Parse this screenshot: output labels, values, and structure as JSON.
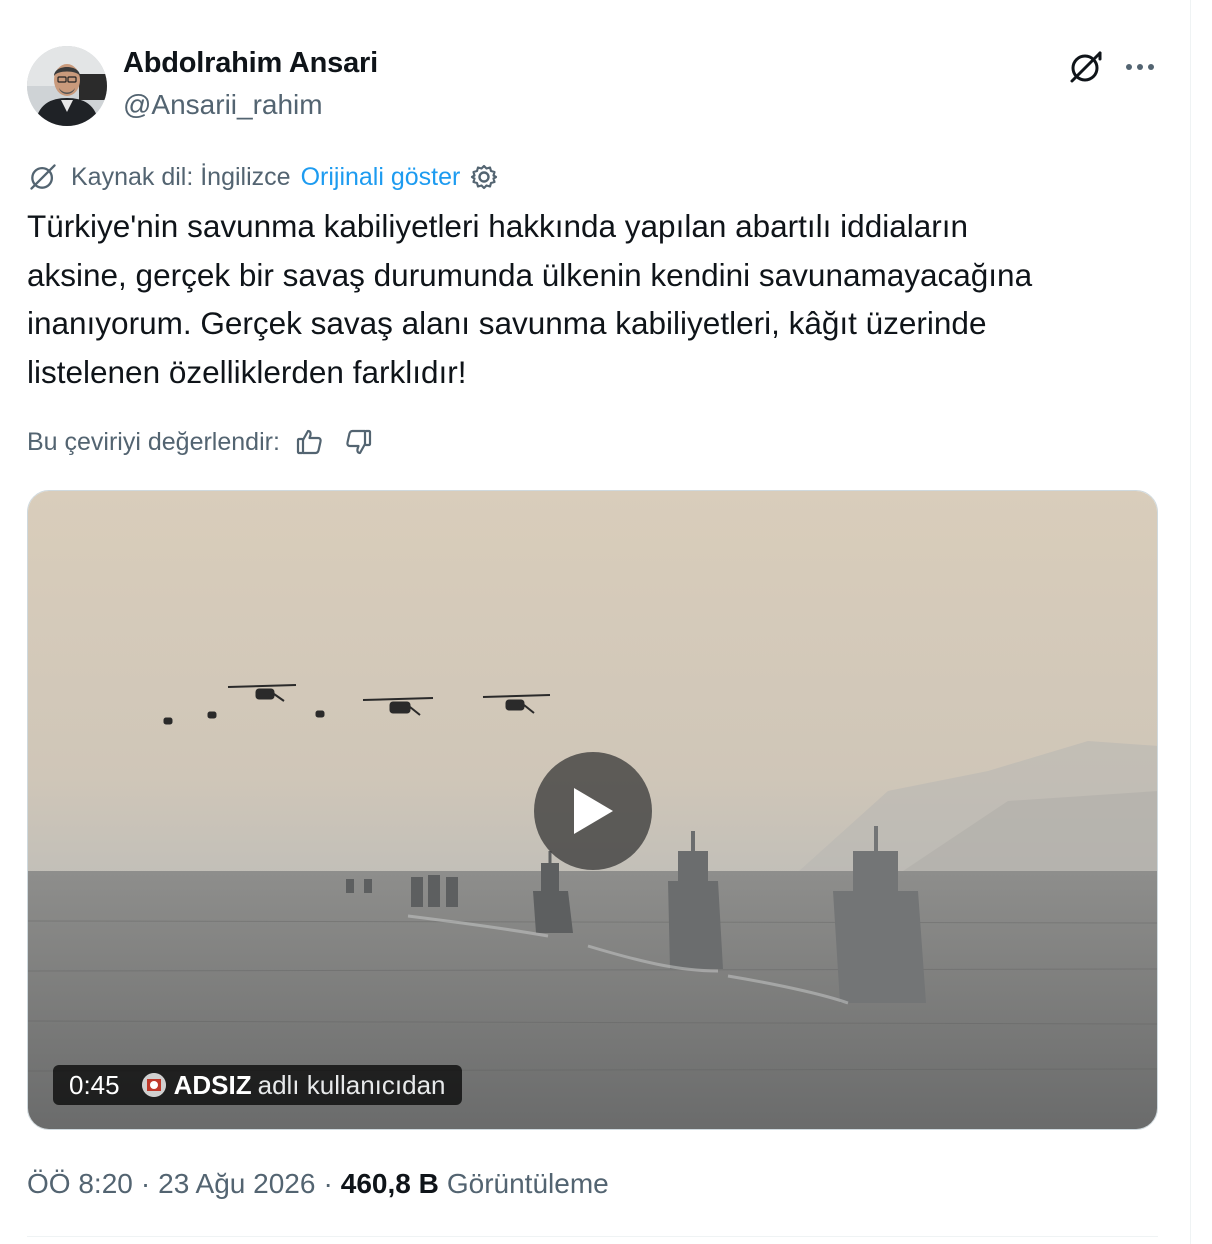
{
  "author": {
    "display_name": "Abdolrahim Ansari",
    "handle": "@Ansarii_rahim"
  },
  "header_icons": {
    "grok": "grok-icon",
    "more": "more-horizontal-icon"
  },
  "translation": {
    "source_label": "Kaynak dil: İngilizce",
    "show_original": "Orijinali göster"
  },
  "tweet": {
    "text": "Türkiye'nin savunma kabiliyetleri hakkında yapılan abartılı iddiaların\naksine, gerçek bir savaş durumunda ülkenin kendini savunamayacağına\ninanıyorum. Gerçek savaş alanı savunma kabiliyetleri, kâğıt üzerinde\nlistelenen özelliklerden farklıdır!"
  },
  "rating": {
    "label": "Bu çeviriyi değerlendir:"
  },
  "video": {
    "duration": "0:45",
    "source_name": "ADSIZ",
    "source_suffix": "adlı kullanıcıdan"
  },
  "meta": {
    "time": "ÖÖ 8:20",
    "date": "23 Ağu 2026",
    "separator": "·",
    "views_count": "460,8 B",
    "views_label": "Görüntüleme"
  },
  "colors": {
    "text": "#0f1419",
    "secondary": "#536471",
    "link": "#1d9bf0"
  }
}
